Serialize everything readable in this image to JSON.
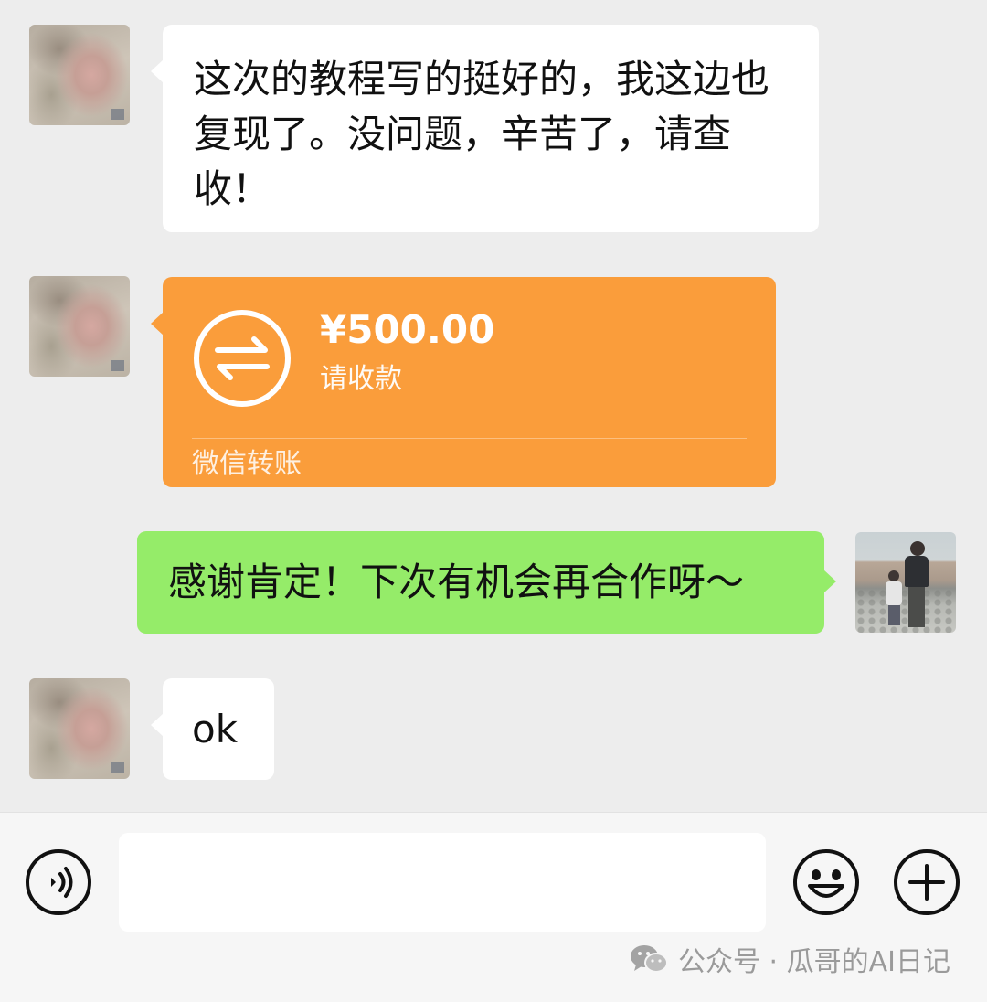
{
  "messages": [
    {
      "sender": "contact",
      "type": "text",
      "text": "这次的教程写的挺好的，我这边也复现了。没问题，辛苦了，请查收！"
    },
    {
      "sender": "contact",
      "type": "transfer",
      "amount": "¥500.00",
      "status": "请收款",
      "source": "微信转账"
    },
    {
      "sender": "me",
      "type": "text",
      "text": "感谢肯定！下次有机会再合作呀～"
    },
    {
      "sender": "contact",
      "type": "text",
      "text": "ok"
    }
  ],
  "input_bar": {
    "voice_icon": "voice-icon",
    "emoji_icon": "emoji-icon",
    "add_icon": "plus-circle-icon",
    "input_value": ""
  },
  "watermark": {
    "text": "公众号 · 瓜哥的AI日记",
    "icon": "wechat-icon"
  },
  "colors": {
    "background": "#ededed",
    "incoming": "#ffffff",
    "outgoing": "#95ec69",
    "transfer": "#fa9d3b"
  }
}
